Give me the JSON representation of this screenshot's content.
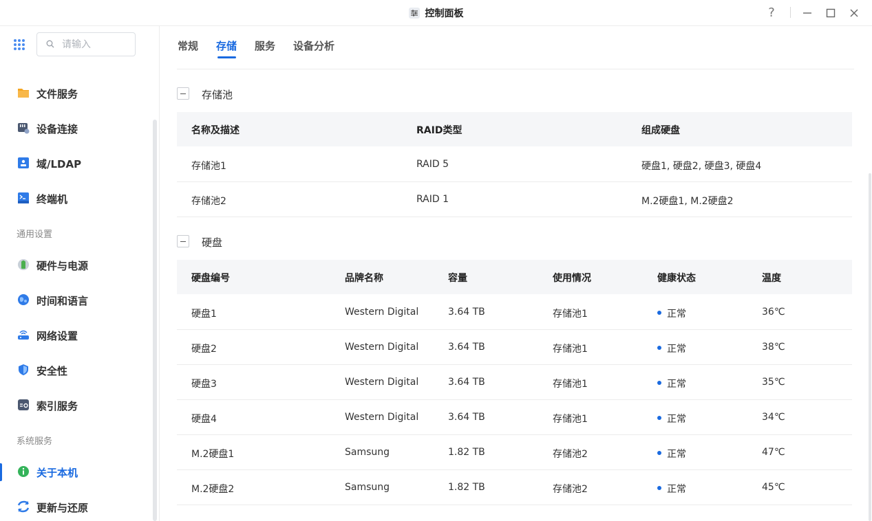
{
  "window": {
    "title": "控制面板",
    "help": "?",
    "minimize": "—",
    "maximize": "☐",
    "close": "✕"
  },
  "search": {
    "placeholder": "请输入"
  },
  "sidebar": {
    "items_top": [
      {
        "label": "文件服务",
        "icon": "folder-icon"
      },
      {
        "label": "设备连接",
        "icon": "device-connect-icon"
      },
      {
        "label": "域/LDAP",
        "icon": "ldap-icon"
      },
      {
        "label": "终端机",
        "icon": "terminal-icon"
      }
    ],
    "section_general": "通用设置",
    "items_general": [
      {
        "label": "硬件与电源",
        "icon": "battery-icon"
      },
      {
        "label": "时间和语言",
        "icon": "globe-icon"
      },
      {
        "label": "网络设置",
        "icon": "router-icon"
      },
      {
        "label": "安全性",
        "icon": "shield-icon"
      },
      {
        "label": "索引服务",
        "icon": "index-icon"
      }
    ],
    "section_system": "系统服务",
    "items_system": [
      {
        "label": "关于本机",
        "icon": "info-icon",
        "active": true
      },
      {
        "label": "更新与还原",
        "icon": "refresh-icon"
      }
    ]
  },
  "tabs": [
    "常规",
    "存储",
    "服务",
    "设备分析"
  ],
  "active_tab": "存储",
  "storage_pools": {
    "title": "存储池",
    "headers": [
      "名称及描述",
      "RAID类型",
      "组成硬盘"
    ],
    "rows": [
      [
        "存储池1",
        "RAID 5",
        "硬盘1, 硬盘2, 硬盘3, 硬盘4"
      ],
      [
        "存储池2",
        "RAID 1",
        "M.2硬盘1, M.2硬盘2"
      ]
    ]
  },
  "disks": {
    "title": "硬盘",
    "headers": [
      "硬盘编号",
      "品牌名称",
      "容量",
      "使用情况",
      "健康状态",
      "温度"
    ],
    "rows": [
      [
        "硬盘1",
        "Western Digital",
        "3.64 TB",
        "存储池1",
        "正常",
        "36℃"
      ],
      [
        "硬盘2",
        "Western Digital",
        "3.64 TB",
        "存储池1",
        "正常",
        "38℃"
      ],
      [
        "硬盘3",
        "Western Digital",
        "3.64 TB",
        "存储池1",
        "正常",
        "35℃"
      ],
      [
        "硬盘4",
        "Western Digital",
        "3.64 TB",
        "存储池1",
        "正常",
        "34℃"
      ],
      [
        "M.2硬盘1",
        "Samsung",
        "1.82 TB",
        "存储池2",
        "正常",
        "47℃"
      ],
      [
        "M.2硬盘2",
        "Samsung",
        "1.82 TB",
        "存储池2",
        "正常",
        "45℃"
      ]
    ]
  },
  "colors": {
    "accent": "#1a6ae0",
    "status_ok": "#1a6ae0"
  }
}
